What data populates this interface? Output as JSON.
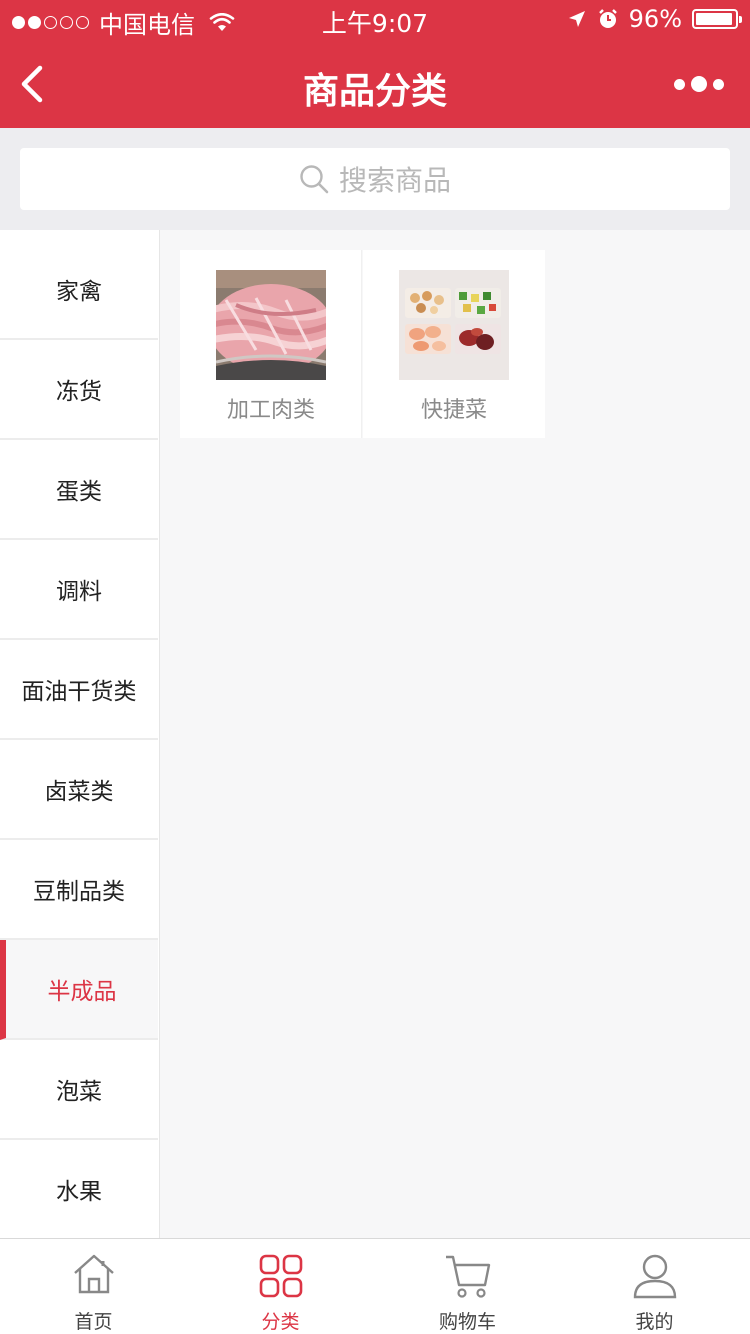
{
  "status_bar": {
    "carrier": "中国电信",
    "time": "上午9:07",
    "battery": "96%",
    "signal_bars_filled": 2,
    "signal_bars_total": 5,
    "battery_level": 0.96
  },
  "nav": {
    "title": "商品分类",
    "back_icon": "chevron-left-icon",
    "more_icon": "more-dots-icon"
  },
  "search": {
    "placeholder": "搜索商品",
    "icon": "search-icon"
  },
  "sidebar": {
    "active_index": 7,
    "items": [
      {
        "label": "家禽"
      },
      {
        "label": "冻货"
      },
      {
        "label": "蛋类"
      },
      {
        "label": "调料"
      },
      {
        "label": "面油干货类"
      },
      {
        "label": "卤菜类"
      },
      {
        "label": "豆制品类"
      },
      {
        "label": "半成品"
      },
      {
        "label": "泡菜"
      },
      {
        "label": "水果"
      }
    ]
  },
  "products": [
    {
      "label": "加工肉类",
      "image": "raw-meat-strips-photo"
    },
    {
      "label": "快捷菜",
      "image": "ready-meal-boxes-photo"
    }
  ],
  "tabbar": {
    "active_index": 1,
    "tabs": [
      {
        "label": "首页",
        "icon": "home-icon"
      },
      {
        "label": "分类",
        "icon": "grid-icon"
      },
      {
        "label": "购物车",
        "icon": "cart-icon"
      },
      {
        "label": "我的",
        "icon": "user-icon"
      }
    ]
  },
  "colors": {
    "brand": "#dc3545",
    "page_bg": "#f7f7f8"
  }
}
